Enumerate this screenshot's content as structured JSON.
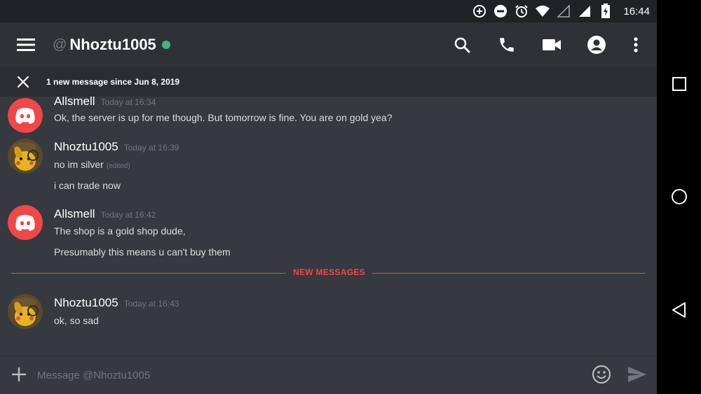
{
  "status_bar": {
    "time": "16:44",
    "icons": [
      "data-saver-icon",
      "do-not-disturb-icon",
      "alarm-icon",
      "wifi-icon",
      "signal-icon",
      "signal-icon",
      "battery-charging-icon"
    ]
  },
  "header": {
    "at_symbol": "@",
    "channel_name": "Nhoztu1005",
    "status": "online"
  },
  "new_message_bar": {
    "text": "1 new message since Jun 8, 2019"
  },
  "messages": [
    {
      "author": "Allsmell",
      "timestamp": "Today at 16:34",
      "avatar": "discord-logo",
      "lines": [
        {
          "text": "Ok, the server is up for me though. But tomorrow is fine. You are on gold yea?",
          "edited": ""
        }
      ]
    },
    {
      "author": "Nhoztu1005",
      "timestamp": "Today at 16:39",
      "avatar": "pikachu-detective",
      "lines": [
        {
          "text": "no im silver",
          "edited": "(edited)"
        },
        {
          "text": "i can trade now",
          "edited": ""
        }
      ]
    },
    {
      "author": "Allsmell",
      "timestamp": "Today at 16:42",
      "avatar": "discord-logo",
      "lines": [
        {
          "text": "The shop is a gold shop dude,",
          "edited": ""
        },
        {
          "text": "Presumably this means u can't buy them",
          "edited": ""
        }
      ]
    },
    {
      "author": "Nhoztu1005",
      "timestamp": "Today at 16:43",
      "avatar": "pikachu-detective",
      "lines": [
        {
          "text": "ok, so sad",
          "edited": ""
        }
      ]
    }
  ],
  "divider": {
    "label": "NEW MESSAGES"
  },
  "composer": {
    "placeholder": "Message @Nhoztu1005",
    "value": ""
  },
  "colors": {
    "background": "#36393f",
    "header": "#2f3136",
    "discord_red": "#f04747",
    "online_green": "#43b581"
  }
}
